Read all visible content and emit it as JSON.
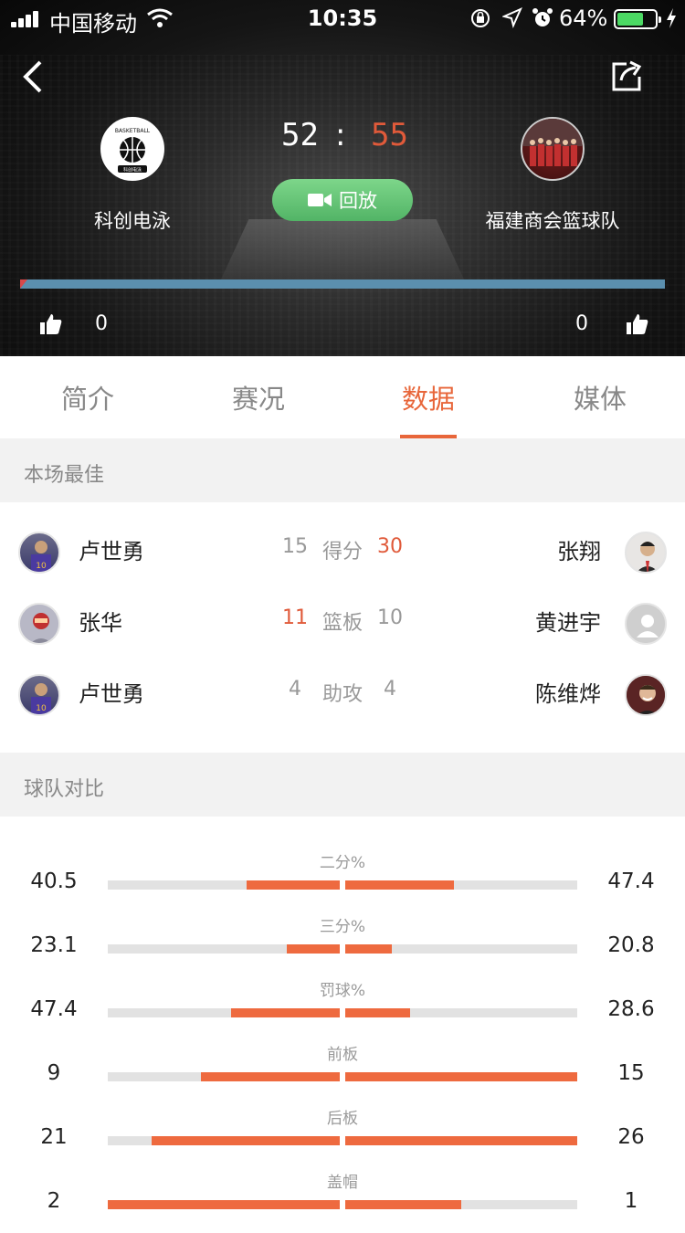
{
  "status_bar": {
    "carrier": "中国移动",
    "time": "10:35",
    "battery": "64%"
  },
  "match": {
    "home_team": "科创电泳",
    "away_team": "福建商会篮球队",
    "home_score": "52",
    "separator": ":",
    "away_score": "55",
    "replay_label": "回放",
    "home_likes": "0",
    "away_likes": "0",
    "home_logo_text": "BASKETBALL",
    "home_logo_sub": "科创电泳"
  },
  "tabs": [
    "简介",
    "赛况",
    "数据",
    "媒体"
  ],
  "active_tab": "数据",
  "best": {
    "title": "本场最佳",
    "rows": [
      {
        "home_player": "卢世勇",
        "home_val": "15",
        "label": "得分",
        "away_val": "30",
        "away_player": "张翔"
      },
      {
        "home_player": "张华",
        "home_val": "11",
        "label": "篮板",
        "away_val": "10",
        "away_player": "黄进宇"
      },
      {
        "home_player": "卢世勇",
        "home_val": "4",
        "label": "助攻",
        "away_val": "4",
        "away_player": "陈维烨"
      }
    ]
  },
  "compare": {
    "title": "球队对比",
    "rows": [
      {
        "label": "二分%",
        "home": "40.5",
        "away": "47.4",
        "home_frac": 0.4,
        "away_frac": 0.47
      },
      {
        "label": "三分%",
        "home": "23.1",
        "away": "20.8",
        "home_frac": 0.23,
        "away_frac": 0.2
      },
      {
        "label": "罚球%",
        "home": "47.4",
        "away": "28.6",
        "home_frac": 0.47,
        "away_frac": 0.28
      },
      {
        "label": "前板",
        "home": "9",
        "away": "15",
        "home_frac": 0.6,
        "away_frac": 1.0
      },
      {
        "label": "后板",
        "home": "21",
        "away": "26",
        "home_frac": 0.81,
        "away_frac": 1.0
      },
      {
        "label": "盖帽",
        "home": "2",
        "away": "1",
        "home_frac": 1.0,
        "away_frac": 0.5
      }
    ]
  },
  "colors": {
    "accent": "#e8663a",
    "replay": "#5cbf6e",
    "possession": "#5b8fae"
  }
}
